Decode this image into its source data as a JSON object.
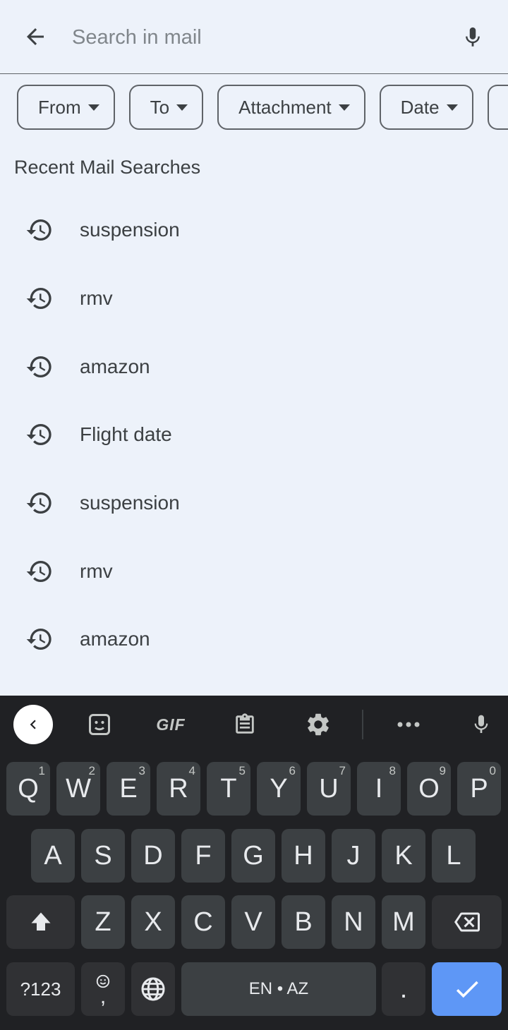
{
  "search": {
    "placeholder": "Search in mail",
    "value": ""
  },
  "icons": {
    "back": "arrow-back-icon",
    "mic": "mic-icon",
    "history": "history-icon"
  },
  "filters": [
    {
      "label": "From"
    },
    {
      "label": "To"
    },
    {
      "label": "Attachment"
    },
    {
      "label": "Date"
    }
  ],
  "recent": {
    "title": "Recent Mail Searches",
    "items": [
      {
        "text": "suspension"
      },
      {
        "text": "rmv"
      },
      {
        "text": "amazon"
      },
      {
        "text": "Flight date"
      },
      {
        "text": "suspension"
      },
      {
        "text": "rmv"
      },
      {
        "text": "amazon"
      }
    ]
  },
  "keyboard": {
    "toolbar": {
      "gif_label": "GIF"
    },
    "row1": [
      {
        "label": "Q",
        "sub": "1"
      },
      {
        "label": "W",
        "sub": "2"
      },
      {
        "label": "E",
        "sub": "3"
      },
      {
        "label": "R",
        "sub": "4"
      },
      {
        "label": "T",
        "sub": "5"
      },
      {
        "label": "Y",
        "sub": "6"
      },
      {
        "label": "U",
        "sub": "7"
      },
      {
        "label": "I",
        "sub": "8"
      },
      {
        "label": "O",
        "sub": "9"
      },
      {
        "label": "P",
        "sub": "0"
      }
    ],
    "row2": [
      "A",
      "S",
      "D",
      "F",
      "G",
      "H",
      "J",
      "K",
      "L"
    ],
    "row3": [
      "Z",
      "X",
      "C",
      "V",
      "B",
      "N",
      "M"
    ],
    "symbols_label": "?123",
    "comma_label": ",",
    "space_label": "EN • AZ",
    "period_label": "."
  },
  "colors": {
    "background": "#edf2fa",
    "keyboard_bg": "#202124",
    "key_bg": "#3c4043",
    "enter_bg": "#5e97f6"
  }
}
